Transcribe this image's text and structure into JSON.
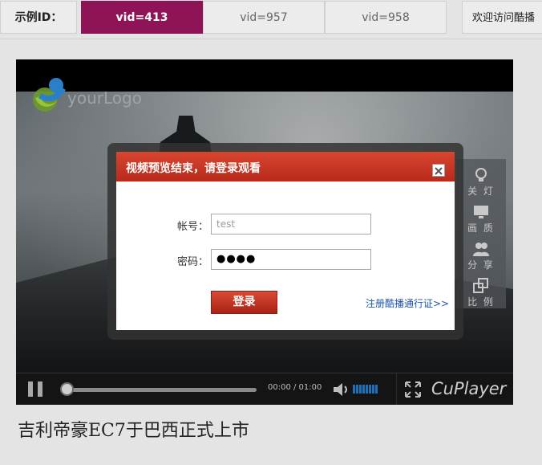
{
  "topbar": {
    "label": "示例ID：",
    "tabs": [
      {
        "label": "vid=413",
        "active": true
      },
      {
        "label": "vid=957",
        "active": false
      },
      {
        "label": "vid=958",
        "active": false
      }
    ],
    "welcome": "欢迎访问酷播"
  },
  "player": {
    "logo_text": "yourLogo",
    "side_tools": [
      {
        "label": "关 灯",
        "icon": "lightbulb-icon"
      },
      {
        "label": "画 质",
        "icon": "monitor-icon"
      },
      {
        "label": "分 享",
        "icon": "people-icon"
      },
      {
        "label": "比 例",
        "icon": "aspect-ratio-icon"
      }
    ],
    "controls": {
      "time": "00:00 / 01:00",
      "progress": 0,
      "volume_bars": 8,
      "brand": "CuPlayer"
    }
  },
  "dialog": {
    "title": "视频预览结束，请登录观看",
    "username_label": "帐号：",
    "username_value": "test",
    "password_label": "密码：",
    "password_value": "●●●●",
    "login_button": "登录",
    "register_link": "注册酷播通行证>>"
  },
  "video_title": "吉利帝豪EC7于巴西正式上市",
  "colors": {
    "active_tab": "#8f1457",
    "dialog_header": "#c8331f",
    "register_link": "#1d55a8",
    "volume": "#1f6fb8"
  }
}
